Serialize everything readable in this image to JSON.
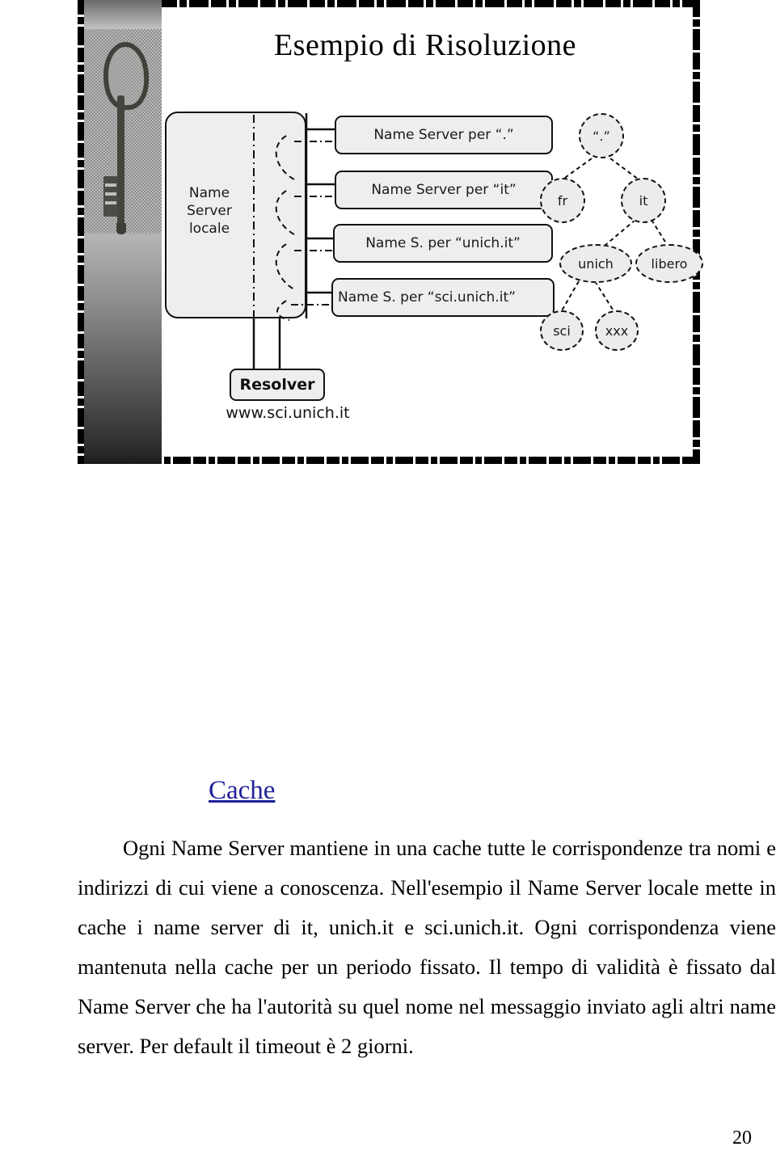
{
  "slide": {
    "title": "Esempio di Risoluzione",
    "photo": {
      "name": "old-key-photograph",
      "alt": "fotografia in scala di grigi di una vecchia chiave"
    },
    "local_server": {
      "label_lines": [
        "Name",
        "Server",
        "locale"
      ],
      "label": "Name Server locale"
    },
    "server_boxes": [
      {
        "label": "Name Server per “.”"
      },
      {
        "label": "Name Server per “it”"
      },
      {
        "label": "Name S. per “unich.it”"
      },
      {
        "label": "Name S. per “sci.unich.it”"
      }
    ],
    "resolver": {
      "label": "Resolver",
      "query": "www.sci.unich.it"
    },
    "tree": {
      "nodes": [
        {
          "id": "root",
          "label": "“.”"
        },
        {
          "id": "fr",
          "label": "fr"
        },
        {
          "id": "it",
          "label": "it"
        },
        {
          "id": "unich",
          "label": "unich"
        },
        {
          "id": "libero",
          "label": "libero"
        },
        {
          "id": "sci",
          "label": "sci"
        },
        {
          "id": "xxx",
          "label": "xxx"
        }
      ],
      "edges": [
        [
          "root",
          "fr"
        ],
        [
          "root",
          "it"
        ],
        [
          "it",
          "unich"
        ],
        [
          "it",
          "libero"
        ],
        [
          "unich",
          "sci"
        ],
        [
          "unich",
          "xxx"
        ]
      ]
    }
  },
  "document": {
    "heading": "Cache",
    "paragraph": "Ogni Name Server mantiene in una cache tutte le corrispondenze tra nomi e indirizzi di cui viene a  conoscenza. Nell'esempio il Name Server locale mette  in cache i name server di it, unich.it e sci.unich.it. Ogni corrispondenza viene mantenuta nella cache per un periodo fissato. Il tempo di validità è fissato dal Name Server che ha l'autorità su quel nome nel messaggio inviato agli altri name server. Per default il timeout è 2 giorni.",
    "page_number": "20"
  },
  "colors": {
    "heading_blue": "#21219c",
    "box_fill": "#eeeeee",
    "line_black": "#111111"
  }
}
